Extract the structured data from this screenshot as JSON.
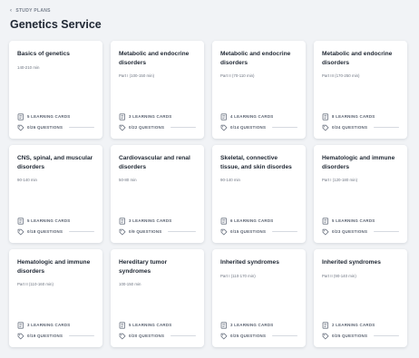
{
  "breadcrumb": {
    "label": "STUDY PLANS",
    "icon": "chevron-left-icon"
  },
  "title": "Genetics Service",
  "colors": {
    "background": "#f1f3f6",
    "card": "#ffffff",
    "text": "#1f2733",
    "muted": "#6e7582"
  },
  "cards": [
    {
      "title": "Basics of genetics",
      "subtitle": "140-210 min",
      "cards_label": "5 LEARNING CARDS",
      "questions_label": "0/26 QUESTIONS",
      "progress": 0
    },
    {
      "title": "Metabolic and endocrine disorders",
      "subtitle": "Part I (100-150 min)",
      "cards_label": "3 LEARNING CARDS",
      "questions_label": "0/22 QUESTIONS",
      "progress": 0
    },
    {
      "title": "Metabolic and endocrine disorders",
      "subtitle": "Part II (70-110 min)",
      "cards_label": "4 LEARNING CARDS",
      "questions_label": "0/14 QUESTIONS",
      "progress": 0
    },
    {
      "title": "Metabolic and endocrine disorders",
      "subtitle": "Part III (170-250 min)",
      "cards_label": "8 LEARNING CARDS",
      "questions_label": "0/34 QUESTIONS",
      "progress": 0
    },
    {
      "title": "CNS, spinal, and muscular disorders",
      "subtitle": "90-140 min",
      "cards_label": "5 LEARNING CARDS",
      "questions_label": "0/18 QUESTIONS",
      "progress": 0
    },
    {
      "title": "Cardiovascular and renal disorders",
      "subtitle": "50-80 min",
      "cards_label": "3 LEARNING CARDS",
      "questions_label": "0/9 QUESTIONS",
      "progress": 0
    },
    {
      "title": "Skeletal, connective tissue, and skin disordes",
      "subtitle": "90-140 min",
      "cards_label": "6 LEARNING CARDS",
      "questions_label": "0/15 QUESTIONS",
      "progress": 0
    },
    {
      "title": "Hematologic and immune disorders",
      "subtitle": "Part I (120-180 min)",
      "cards_label": "5 LEARNING CARDS",
      "questions_label": "0/23 QUESTIONS",
      "progress": 0
    },
    {
      "title": "Hematologic and immune disorders",
      "subtitle": "Part II (110-160 min)",
      "cards_label": "3 LEARNING CARDS",
      "questions_label": "0/19 QUESTIONS",
      "progress": 0
    },
    {
      "title": "Hereditary tumor syndromes",
      "subtitle": "100-150 min",
      "cards_label": "5 LEARNING CARDS",
      "questions_label": "0/20 QUESTIONS",
      "progress": 0
    },
    {
      "title": "Inherited syndromes",
      "subtitle": "Part I (110-170 min)",
      "cards_label": "3 LEARNING CARDS",
      "questions_label": "0/25 QUESTIONS",
      "progress": 0
    },
    {
      "title": "Inherited syndromes",
      "subtitle": "Part II (90-140 min)",
      "cards_label": "2 LEARNING CARDS",
      "questions_label": "0/25 QUESTIONS",
      "progress": 0
    }
  ],
  "icons": {
    "learning_cards": "book-icon",
    "questions": "question-tag-icon"
  }
}
